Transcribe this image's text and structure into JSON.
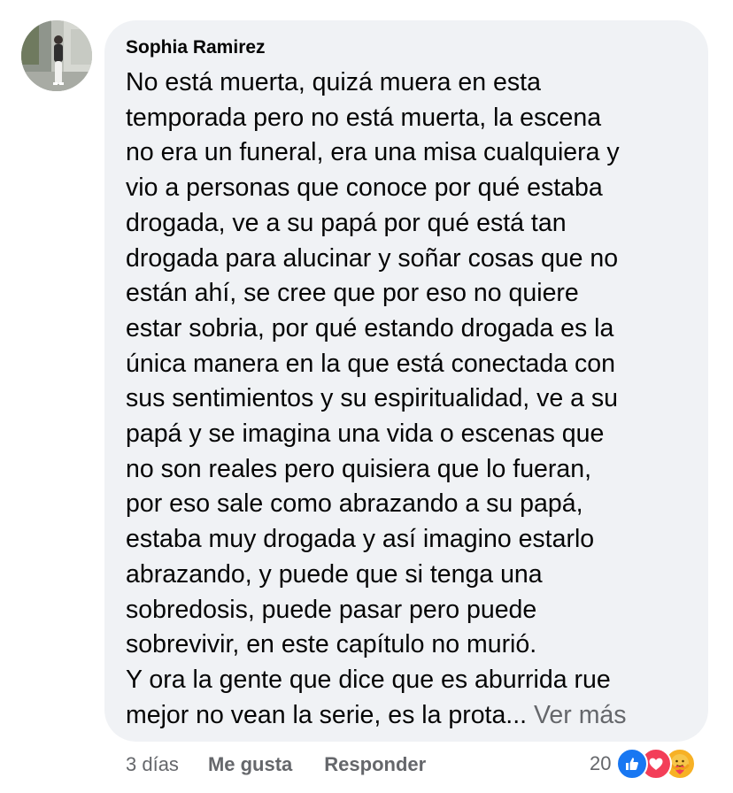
{
  "comment": {
    "author": "Sophia Ramirez",
    "body_lines": [
      "No está muerta, quizá muera en esta",
      "temporada pero no está muerta, la escena",
      "no era un funeral, era una misa cualquiera y",
      "vio a personas que conoce por qué estaba",
      "drogada, ve a su papá por qué está tan",
      "drogada para alucinar y soñar cosas que no",
      "están ahí, se cree que por eso no quiere",
      "estar sobria, por qué estando drogada es la",
      "única manera en la que está conectada con",
      "sus sentimientos y su espiritualidad, ve a su",
      "papá y se imagina una vida o escenas que",
      "no son reales pero quisiera que lo fueran,",
      "por eso sale como abrazando a su papá,",
      "estaba muy drogada y así imagino estarlo",
      "abrazando, y puede que si tenga una",
      "sobredosis, puede pasar pero puede",
      "sobrevivir, en este capítulo no murió.",
      "Y ora la gente que dice que es aburrida rue"
    ],
    "last_line": "mejor no vean la serie, es la prota...",
    "see_more": "Ver más"
  },
  "actions": {
    "time": "3 días",
    "like": "Me gusta",
    "reply": "Responder"
  },
  "reactions": {
    "count": "20",
    "icons": [
      "like-icon",
      "love-icon",
      "care-icon"
    ],
    "colors": {
      "like": "#1877f2",
      "love": "#f33e58",
      "care": "#f7b125"
    }
  }
}
